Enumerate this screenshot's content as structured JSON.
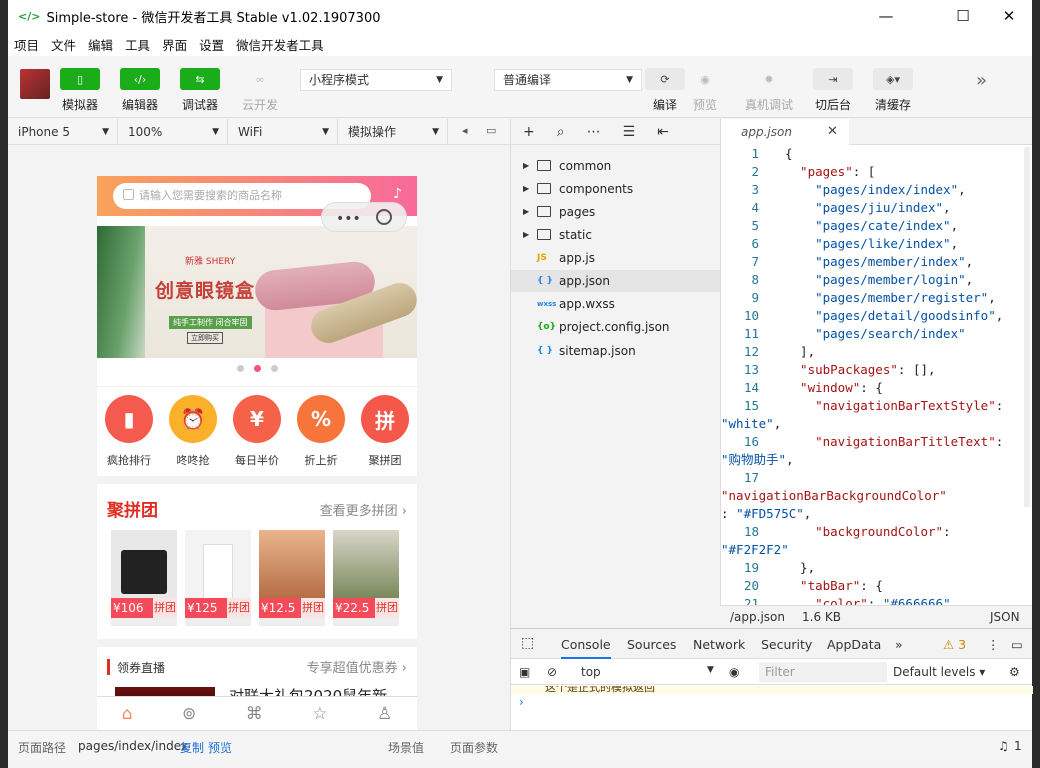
{
  "window": {
    "title": "Simple-store - 微信开发者工具 Stable v1.02.1907300",
    "logo": "</>",
    "min": "—",
    "max": "☐",
    "close": "✕"
  },
  "menu": [
    "项目",
    "文件",
    "编辑",
    "工具",
    "界面",
    "设置",
    "微信开发者工具"
  ],
  "toolbar": {
    "simulator": "模拟器",
    "editor": "编辑器",
    "debugger": "调试器",
    "cloud": "云开发",
    "mode_select": "小程序模式",
    "compile_select": "普通编译",
    "compile": "编译",
    "preview": "预览",
    "real_debug": "真机调试",
    "background": "切后台",
    "clear_cache": "清缓存",
    "more": "»"
  },
  "device_bar": {
    "device": "iPhone 5",
    "zoom": "100%",
    "network": "WiFi",
    "operation": "模拟操作"
  },
  "phone": {
    "search_placeholder": "请输入您需要搜索的商品名称",
    "banner": {
      "brand": "新雅 SHERY",
      "headline": "创意眼镜盒",
      "sub": "纯手工制作  闭合牢固",
      "cta": "立即购买"
    },
    "icons": [
      {
        "label": "疯抢排行",
        "color": "#f55a4e",
        "glyph": "▮"
      },
      {
        "label": "咚咚抢",
        "color": "#fbb02a",
        "glyph": "⏰"
      },
      {
        "label": "每日半价",
        "color": "#f6614a",
        "glyph": "¥"
      },
      {
        "label": "折上折",
        "color": "#f7743a",
        "glyph": "%"
      },
      {
        "label": "聚拼团",
        "color": "#f5574a",
        "glyph": "拼"
      }
    ],
    "group_title": "聚拼团",
    "group_more": "查看更多拼团 ›",
    "products": [
      {
        "price": "¥106",
        "tag": "拼团",
        "bg": "#e8e8e8"
      },
      {
        "price": "¥125",
        "tag": "拼团",
        "bg": "#f3f3f3"
      },
      {
        "price": "¥12.5",
        "tag": "拼团",
        "bg": "#e9b58e"
      },
      {
        "price": "¥22.5",
        "tag": "拼团",
        "bg": "#c9cfb8"
      }
    ],
    "live_title": "领券直播",
    "live_more": "专享超值优惠券 ›",
    "live_item": "对联大礼包2020鼠年新"
  },
  "explorer": {
    "toolbar": [
      "+",
      "⌕",
      "⋯",
      "☰",
      "⇤"
    ],
    "files": [
      {
        "name": "common",
        "type": "folder"
      },
      {
        "name": "components",
        "type": "folder"
      },
      {
        "name": "pages",
        "type": "folder"
      },
      {
        "name": "static",
        "type": "folder"
      },
      {
        "name": "app.js",
        "type": "js"
      },
      {
        "name": "app.json",
        "type": "json"
      },
      {
        "name": "app.wxss",
        "type": "wxss"
      },
      {
        "name": "project.config.json",
        "type": "config"
      },
      {
        "name": "sitemap.json",
        "type": "json"
      }
    ]
  },
  "editor": {
    "tab": "app.json",
    "status_path": "/app.json",
    "status_size": "1.6 KB",
    "status_lang": "JSON"
  },
  "console": {
    "tabs": [
      "Console",
      "Sources",
      "Network",
      "Security",
      "AppData"
    ],
    "context": "top",
    "filter": "Filter",
    "levels": "Default levels ▾",
    "warnings": "⚠ 3",
    "message": "这个是正式的模拟返回"
  },
  "statusbar": {
    "path_label": "页面路径",
    "path": "pages/index/index",
    "copy": "复制",
    "preview": "预览",
    "scene": "场景值",
    "params": "页面参数",
    "notif": "1"
  }
}
